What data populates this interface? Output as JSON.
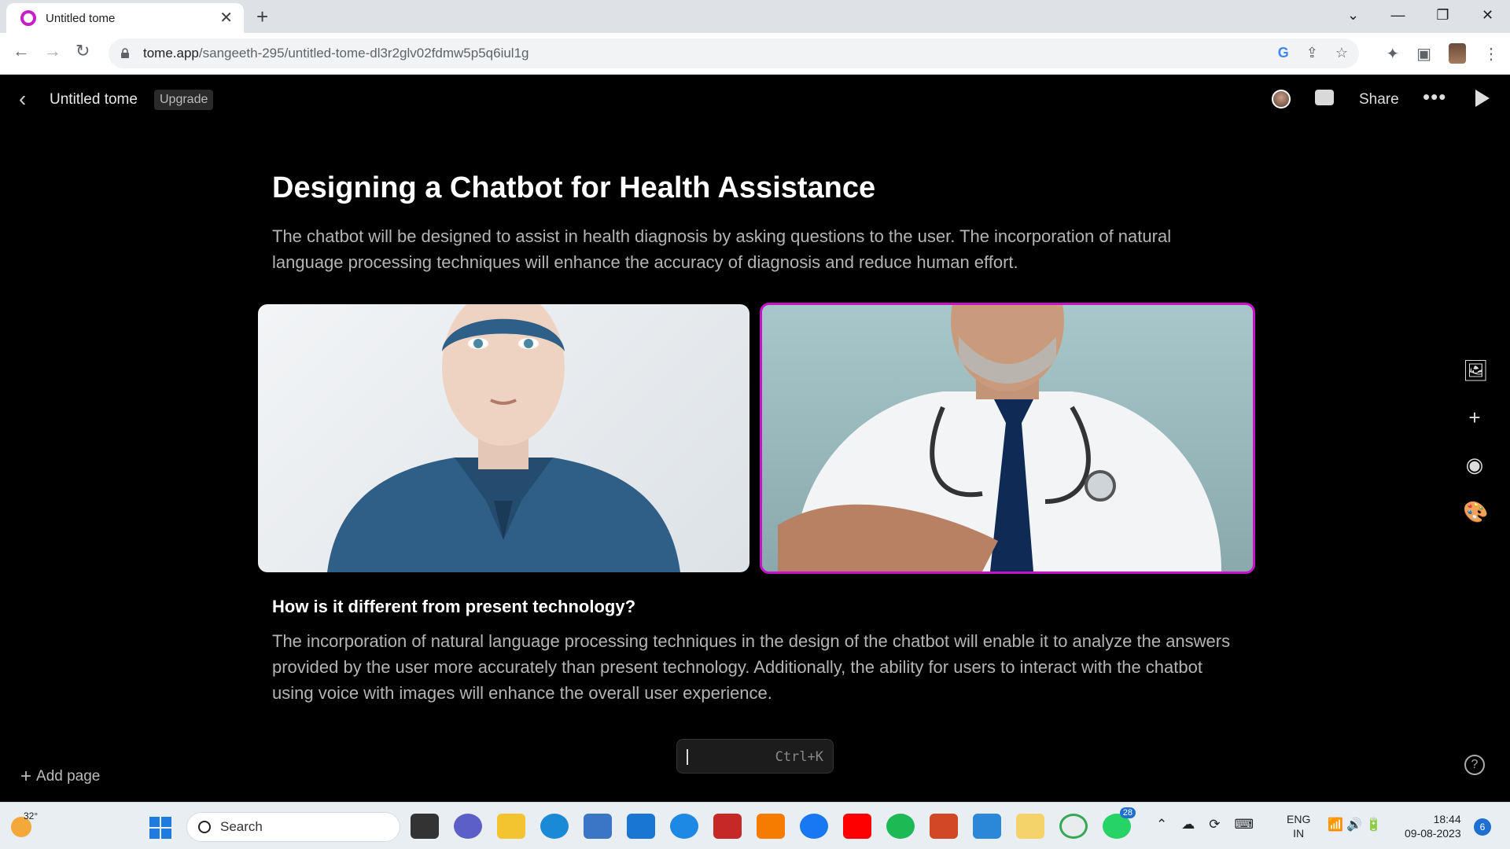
{
  "browser": {
    "tab_title": "Untitled tome",
    "url_host": "tome.app",
    "url_path": "/sangeeth-295/untitled-tome-dl3r2glv02fdmw5p5q6iul1g"
  },
  "app": {
    "doc_title": "Untitled tome",
    "upgrade_label": "Upgrade",
    "share_label": "Share",
    "add_page_label": "Add page",
    "command_hint": "Ctrl+K",
    "accent_color": "#c812c8"
  },
  "page": {
    "title": "Designing a Chatbot for Health Assistance",
    "intro": "The chatbot will be designed to assist in health diagnosis by asking questions to the user. The incorporation of natural language processing techniques will enhance the accuracy of diagnosis and reduce human effort.",
    "subheading": "How is it different from present technology?",
    "body": "The incorporation of natural language processing techniques in the design of the chatbot will enable it to analyze the answers provided by the user more accurately than present technology. Additionally, the ability for users to interact with the chatbot using voice with images will enhance the overall user experience."
  },
  "taskbar": {
    "temperature": "32°",
    "search_label": "Search",
    "whatsapp_badge": "28",
    "lang_line1": "ENG",
    "lang_line2": "IN",
    "time": "18:44",
    "date": "09-08-2023",
    "notification_count": "6"
  }
}
